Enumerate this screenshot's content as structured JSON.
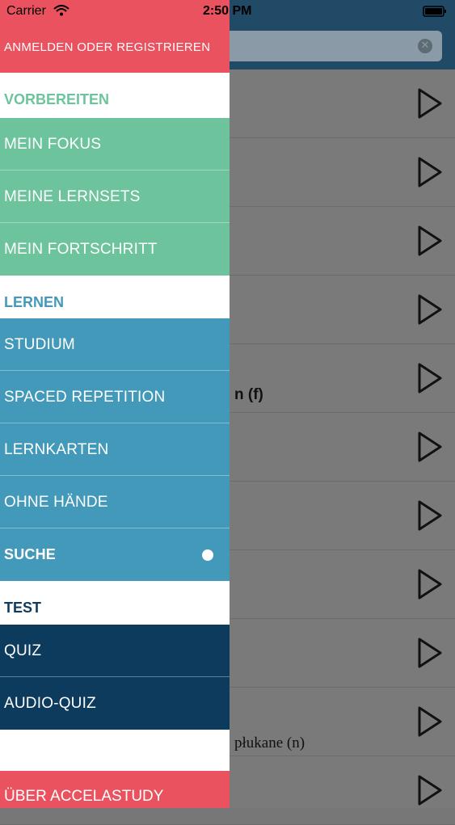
{
  "status_bar": {
    "carrier": "Carrier",
    "time": "2:50 PM"
  },
  "drawer": {
    "login": "ANMELDEN ODER REGISTRIEREN",
    "sections": [
      {
        "header": "VORBEREITEN",
        "color": "#6dc49c",
        "items": [
          "MEIN FOKUS",
          "MEINE LERNSETS",
          "MEIN FORTSCHRITT"
        ]
      },
      {
        "header": "LERNEN",
        "color": "#4399b9",
        "items": [
          "STUDIUM",
          "SPACED REPETITION",
          "LERNKARTEN",
          "OHNE HÄNDE",
          "SUCHE"
        ]
      },
      {
        "header": "TEST",
        "color": "#0d3b5e",
        "items": [
          "QUIZ",
          "AUDIO-QUIZ"
        ]
      }
    ],
    "selected_item": "SUCHE",
    "footer": "ÜBER ACCELASTUDY"
  },
  "background_list": {
    "visible_fragments": [
      "n (f)",
      "płukane (n)"
    ]
  },
  "colors": {
    "accent_red": "#e9525e",
    "prepare_green": "#6dc49c",
    "learn_blue": "#4399b9",
    "test_navy": "#0d3b5e"
  }
}
